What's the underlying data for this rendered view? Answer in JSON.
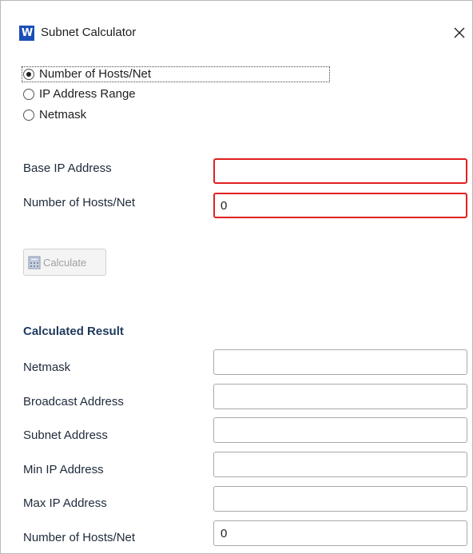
{
  "window": {
    "title": "Subnet Calculator",
    "icon": "app-logo-icon",
    "close_icon": "close-icon"
  },
  "mode": {
    "options": [
      {
        "label": "Number of Hosts/Net",
        "checked": true
      },
      {
        "label": "IP Address Range",
        "checked": false
      },
      {
        "label": "Netmask",
        "checked": false
      }
    ]
  },
  "inputs": {
    "base_ip_label": "Base IP Address",
    "base_ip_value": "",
    "hosts_label": "Number of Hosts/Net",
    "hosts_value": "0"
  },
  "calculate": {
    "label": "Calculate",
    "icon": "calculator-icon"
  },
  "result": {
    "title": "Calculated Result",
    "fields": [
      {
        "label": "Netmask",
        "value": ""
      },
      {
        "label": "Broadcast Address",
        "value": ""
      },
      {
        "label": "Subnet Address",
        "value": ""
      },
      {
        "label": "Min IP Address",
        "value": ""
      },
      {
        "label": "Max IP Address",
        "value": ""
      },
      {
        "label": "Number of Hosts/Net",
        "value": "0"
      }
    ]
  },
  "colors": {
    "error_border": "#e02020",
    "section_title": "#1e3a5c",
    "app_icon_bg": "#1a4fb8"
  }
}
